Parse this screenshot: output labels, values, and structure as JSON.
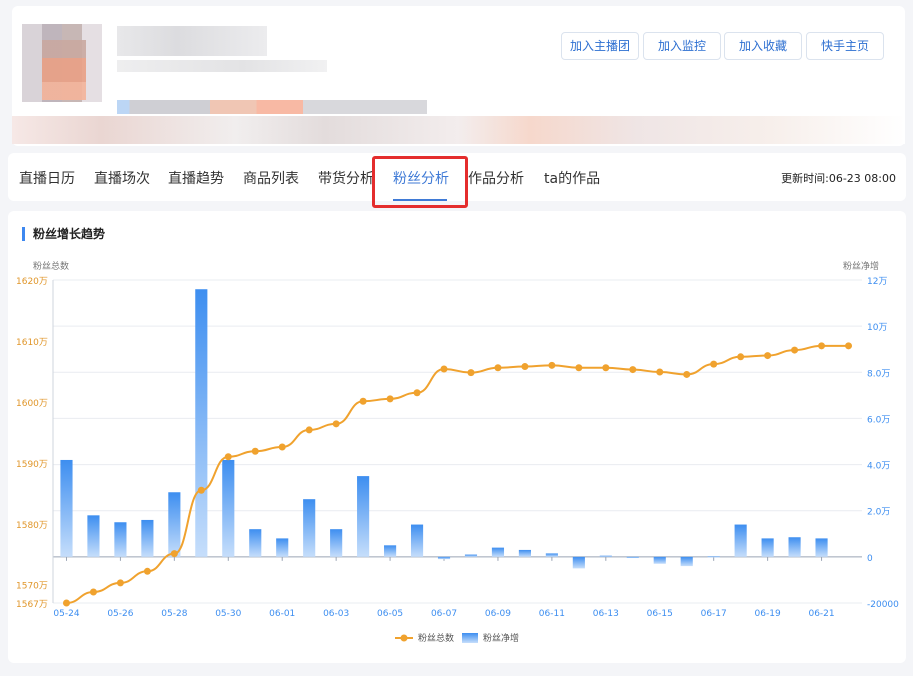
{
  "profile": {
    "buttons": [
      "加入主播团",
      "加入监控",
      "加入收藏",
      "快手主页"
    ]
  },
  "tabs": {
    "items": [
      "直播日历",
      "直播场次",
      "直播趋势",
      "商品列表",
      "带货分析",
      "粉丝分析",
      "作品分析",
      "ta的作品"
    ],
    "active": "粉丝分析",
    "update_time": "更新时间:06-23 08:00"
  },
  "chart": {
    "section_title": "粉丝增长趋势"
  },
  "chart_data": {
    "type": "bar+line",
    "left_axis": {
      "label": "粉丝总数",
      "ticks": [
        "1567万",
        "1570万",
        "1580万",
        "1590万",
        "1600万",
        "1610万",
        "1620万"
      ],
      "range": [
        1567,
        1620
      ]
    },
    "right_axis": {
      "label": "粉丝净增",
      "ticks": [
        "-20000",
        "0",
        "2.0万",
        "4.0万",
        "6.0万",
        "8.0万",
        "10万",
        "12万"
      ],
      "range": [
        -20000,
        120000
      ]
    },
    "x_ticks": [
      "05-24",
      "05-26",
      "05-28",
      "05-30",
      "06-01",
      "06-03",
      "06-05",
      "06-07",
      "06-09",
      "06-11",
      "06-13",
      "06-15",
      "06-17",
      "06-19",
      "06-21"
    ],
    "categories": [
      "05-24",
      "05-25",
      "05-26",
      "05-27",
      "05-28",
      "05-29",
      "05-30",
      "05-31",
      "06-01",
      "06-02",
      "06-03",
      "06-04",
      "06-05",
      "06-06",
      "06-07",
      "06-08",
      "06-09",
      "06-10",
      "06-11",
      "06-12",
      "06-13",
      "06-14",
      "06-15",
      "06-16",
      "06-17",
      "06-18",
      "06-19",
      "06-20",
      "06-21",
      "06-22"
    ],
    "series": [
      {
        "name": "粉丝总数",
        "type": "line",
        "axis": "left",
        "color": "#f0a22e",
        "values": [
          1567.0,
          1568.8,
          1570.3,
          1572.2,
          1575.1,
          1585.5,
          1591.0,
          1591.9,
          1592.6,
          1595.4,
          1596.4,
          1600.1,
          1600.5,
          1601.5,
          1605.4,
          1604.8,
          1605.6,
          1605.8,
          1606.0,
          1605.6,
          1605.6,
          1605.3,
          1604.9,
          1604.5,
          1606.2,
          1607.4,
          1607.6,
          1608.5,
          1609.2,
          1609.2
        ]
      },
      {
        "name": "粉丝净增",
        "type": "bar",
        "axis": "right",
        "color": "#3d8ef0",
        "values": [
          42000,
          18000,
          15000,
          16000,
          28000,
          116000,
          42000,
          12000,
          8000,
          25000,
          12000,
          35000,
          5000,
          14000,
          -1000,
          1000,
          4000,
          3000,
          1500,
          -5000,
          500,
          -500,
          -3000,
          -4000,
          200,
          14000,
          8000,
          8500,
          8000,
          0
        ]
      }
    ],
    "legend": {
      "position": "bottom-center",
      "entries": [
        "粉丝总数",
        "粉丝净增"
      ]
    },
    "grid": true
  },
  "colors": {
    "accent": "#3f7ad6",
    "line": "#f0a22e",
    "bar": "#3d8ef0",
    "highlight_box": "#e42d2d"
  }
}
